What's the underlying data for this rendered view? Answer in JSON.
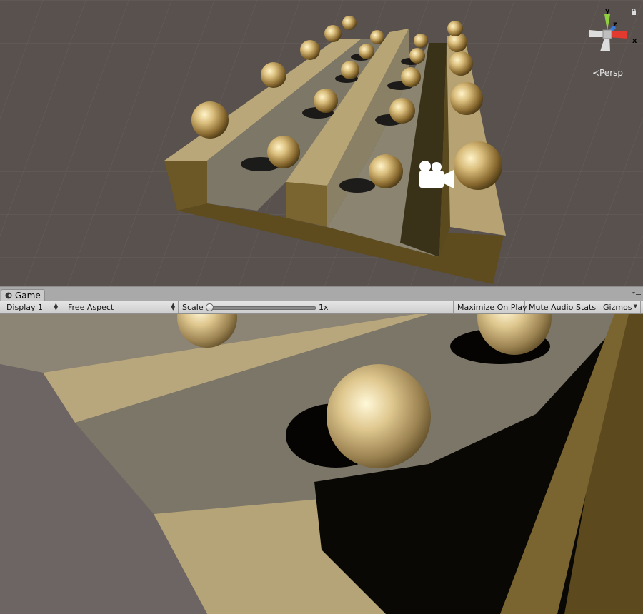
{
  "scene_view": {
    "gizmo_axes": {
      "y": "y",
      "z": "z",
      "x": "x"
    },
    "projection_label": "Persp",
    "icons": {
      "lock": "lock-icon",
      "camera": "camera-icon",
      "orientation": "scene-gizmo-icon"
    },
    "colors": {
      "ground": "#5a5350",
      "grid": "#6b6461",
      "board": "#bba77a",
      "sphere": "#c9ad6a"
    }
  },
  "game_panel": {
    "tab_label": "Game",
    "tab_icon": "game-controller-icon",
    "toolbar": {
      "display": "Display 1",
      "aspect": "Free Aspect",
      "scale_label": "Scale",
      "scale_value": "1x",
      "maximize_on_play": "Maximize On Play",
      "mute_audio": "Mute Audio",
      "stats": "Stats",
      "gizmos": "Gizmos"
    }
  }
}
